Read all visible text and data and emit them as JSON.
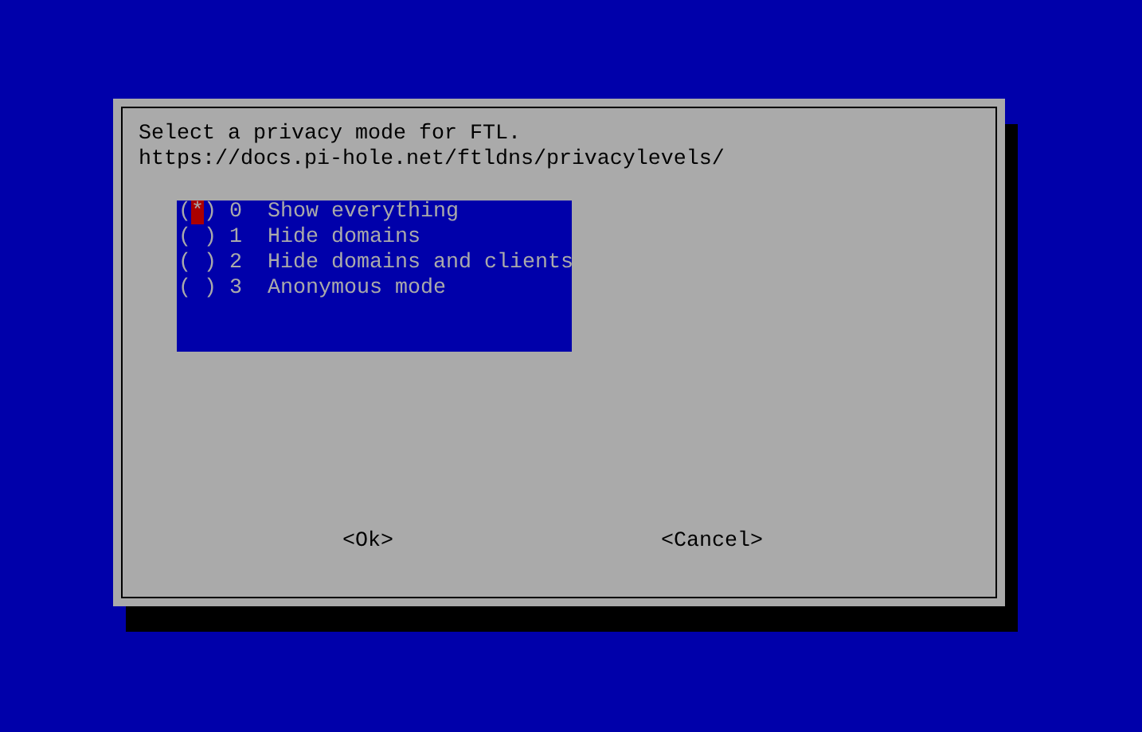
{
  "dialog": {
    "message_lines": [
      "Select a privacy mode for FTL.",
      "https://docs.pi-hole.net/ftldns/privacylevels/"
    ],
    "options": [
      {
        "radio": "(*)",
        "number": "0",
        "label": "Show everything",
        "selected": true
      },
      {
        "radio": "( )",
        "number": "1",
        "label": "Hide domains",
        "selected": false
      },
      {
        "radio": "( )",
        "number": "2",
        "label": "Hide domains and clients",
        "selected": false
      },
      {
        "radio": "( )",
        "number": "3",
        "label": "Anonymous mode",
        "selected": false
      }
    ],
    "buttons": [
      "<Ok>",
      "<Cancel>"
    ]
  }
}
